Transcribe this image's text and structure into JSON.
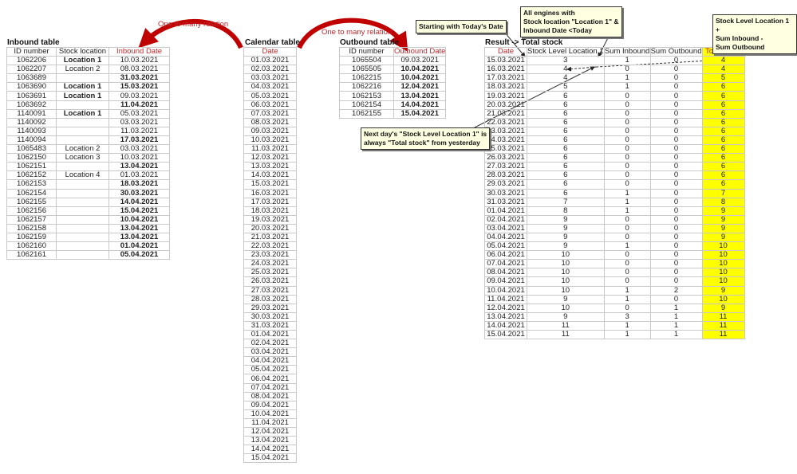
{
  "inbound": {
    "title": "Inbound table",
    "headers": [
      "ID number",
      "Stock location",
      "Inbound Date"
    ],
    "rows": [
      [
        "1062206",
        "Location 1",
        "10.03.2021",
        true,
        false
      ],
      [
        "1062207",
        "Location 2",
        "08.03.2021",
        false,
        false
      ],
      [
        "1063689",
        "",
        "31.03.2021",
        false,
        true
      ],
      [
        "1063690",
        "Location 1",
        "15.03.2021",
        true,
        true
      ],
      [
        "1063691",
        "Location 1",
        "09.03.2021",
        true,
        false
      ],
      [
        "1063692",
        "",
        "11.04.2021",
        false,
        true
      ],
      [
        "1140091",
        "Location 1",
        "05.03.2021",
        true,
        false
      ],
      [
        "1140092",
        "",
        "03.03.2021",
        false,
        false
      ],
      [
        "1140093",
        "",
        "11.03.2021",
        false,
        false
      ],
      [
        "1140094",
        "",
        "17.03.2021",
        false,
        true
      ],
      [
        "1065483",
        "Location 2",
        "03.03.2021",
        false,
        false
      ],
      [
        "1062150",
        "Location 3",
        "10.03.2021",
        false,
        false
      ],
      [
        "1062151",
        "",
        "13.04.2021",
        false,
        true
      ],
      [
        "1062152",
        "Location 4",
        "01.03.2021",
        false,
        false
      ],
      [
        "1062153",
        "",
        "18.03.2021",
        false,
        true
      ],
      [
        "1062154",
        "",
        "30.03.2021",
        false,
        true
      ],
      [
        "1062155",
        "",
        "14.04.2021",
        false,
        true
      ],
      [
        "1062156",
        "",
        "15.04.2021",
        false,
        true
      ],
      [
        "1062157",
        "",
        "10.04.2021",
        false,
        true
      ],
      [
        "1062158",
        "",
        "13.04.2021",
        false,
        true
      ],
      [
        "1062159",
        "",
        "13.04.2021",
        false,
        true
      ],
      [
        "1062160",
        "",
        "01.04.2021",
        false,
        true
      ],
      [
        "1062161",
        "",
        "05.04.2021",
        false,
        true
      ]
    ]
  },
  "calendar": {
    "title": "Calendar table",
    "header": "Date",
    "dates": [
      "01.03.2021",
      "02.03.2021",
      "03.03.2021",
      "04.03.2021",
      "05.03.2021",
      "06.03.2021",
      "07.03.2021",
      "08.03.2021",
      "09.03.2021",
      "10.03.2021",
      "11.03.2021",
      "12.03.2021",
      "13.03.2021",
      "14.03.2021",
      "15.03.2021",
      "16.03.2021",
      "17.03.2021",
      "18.03.2021",
      "19.03.2021",
      "20.03.2021",
      "21.03.2021",
      "22.03.2021",
      "23.03.2021",
      "24.03.2021",
      "25.03.2021",
      "26.03.2021",
      "27.03.2021",
      "28.03.2021",
      "29.03.2021",
      "30.03.2021",
      "31.03.2021",
      "01.04.2021",
      "02.04.2021",
      "03.04.2021",
      "04.04.2021",
      "05.04.2021",
      "06.04.2021",
      "07.04.2021",
      "08.04.2021",
      "09.04.2021",
      "10.04.2021",
      "11.04.2021",
      "12.04.2021",
      "13.04.2021",
      "14.04.2021",
      "15.04.2021"
    ]
  },
  "outbound": {
    "title": "Outbound table",
    "headers": [
      "ID number",
      "Outbound Date"
    ],
    "rows": [
      [
        "1065504",
        "09.03.2021",
        false
      ],
      [
        "1065505",
        "10.04.2021",
        true
      ],
      [
        "1062215",
        "10.04.2021",
        true
      ],
      [
        "1062216",
        "12.04.2021",
        true
      ],
      [
        "1062153",
        "13.04.2021",
        true
      ],
      [
        "1062154",
        "14.04.2021",
        true
      ],
      [
        "1062155",
        "15.04.2021",
        true
      ]
    ]
  },
  "result": {
    "title": "Result -> Total stock",
    "headers": [
      "Date",
      "Stock Level Location 1",
      "Sum Inbound",
      "Sum Outbound",
      "Total stock"
    ],
    "rows": [
      [
        "15.03.2021",
        3,
        1,
        0,
        4
      ],
      [
        "16.03.2021",
        4,
        0,
        0,
        4
      ],
      [
        "17.03.2021",
        4,
        1,
        0,
        5
      ],
      [
        "18.03.2021",
        5,
        1,
        0,
        6
      ],
      [
        "19.03.2021",
        6,
        0,
        0,
        6
      ],
      [
        "20.03.2021",
        6,
        0,
        0,
        6
      ],
      [
        "21.03.2021",
        6,
        0,
        0,
        6
      ],
      [
        "22.03.2021",
        6,
        0,
        0,
        6
      ],
      [
        "23.03.2021",
        6,
        0,
        0,
        6
      ],
      [
        "24.03.2021",
        6,
        0,
        0,
        6
      ],
      [
        "25.03.2021",
        6,
        0,
        0,
        6
      ],
      [
        "26.03.2021",
        6,
        0,
        0,
        6
      ],
      [
        "27.03.2021",
        6,
        0,
        0,
        6
      ],
      [
        "28.03.2021",
        6,
        0,
        0,
        6
      ],
      [
        "29.03.2021",
        6,
        0,
        0,
        6
      ],
      [
        "30.03.2021",
        6,
        1,
        0,
        7
      ],
      [
        "31.03.2021",
        7,
        1,
        0,
        8
      ],
      [
        "01.04.2021",
        8,
        1,
        0,
        9
      ],
      [
        "02.04.2021",
        9,
        0,
        0,
        9
      ],
      [
        "03.04.2021",
        9,
        0,
        0,
        9
      ],
      [
        "04.04.2021",
        9,
        0,
        0,
        9
      ],
      [
        "05.04.2021",
        9,
        1,
        0,
        10
      ],
      [
        "06.04.2021",
        10,
        0,
        0,
        10
      ],
      [
        "07.04.2021",
        10,
        0,
        0,
        10
      ],
      [
        "08.04.2021",
        10,
        0,
        0,
        10
      ],
      [
        "09.04.2021",
        10,
        0,
        0,
        10
      ],
      [
        "10.04.2021",
        10,
        1,
        2,
        9
      ],
      [
        "11.04.2021",
        9,
        1,
        0,
        10
      ],
      [
        "12.04.2021",
        10,
        0,
        1,
        9
      ],
      [
        "13.04.2021",
        9,
        3,
        1,
        11
      ],
      [
        "14.04.2021",
        11,
        1,
        1,
        11
      ],
      [
        "15.04.2021",
        11,
        1,
        1,
        11
      ]
    ]
  },
  "relations": {
    "left": "One to many relation",
    "right": "One to many relation"
  },
  "notes": {
    "today": "Starting with Today's Date",
    "engines": [
      "All engines with",
      "Stock location \"Location 1\" &",
      "Inbound Date <Today"
    ],
    "formula": [
      "Stock Level Location 1 +",
      "Sum Inbound -",
      "Sum Outbound"
    ],
    "nextday": [
      "Next day's \"Stock Level Location 1\" is",
      "always \"Total stock\" from yesterday"
    ]
  },
  "colors": {
    "header_red": "#c0282d",
    "highlight": "#ffff00",
    "note_bg": "#ffffe1",
    "arrow": "#c00000"
  }
}
